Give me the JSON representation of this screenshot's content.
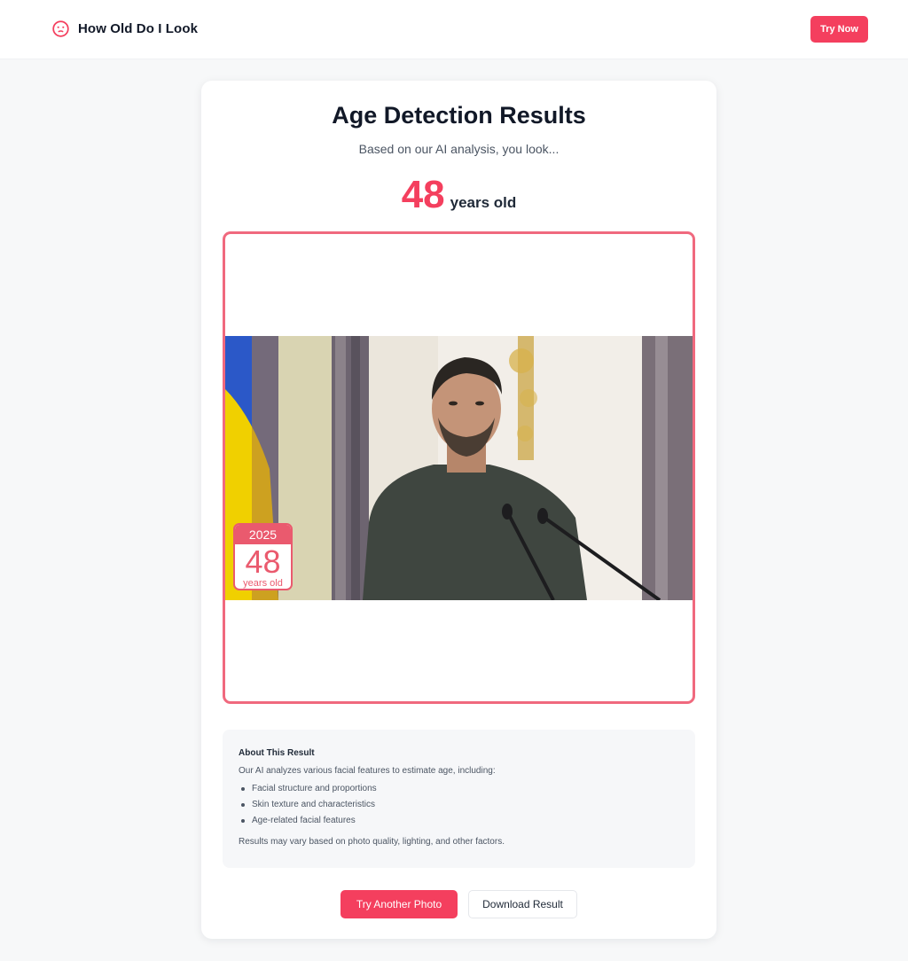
{
  "header": {
    "brand_title": "How Old Do I Look",
    "brand_icon": "face-icon",
    "try_now_label": "Try Now"
  },
  "result": {
    "title": "Age Detection Results",
    "subtitle": "Based on our AI analysis, you look...",
    "age": "48",
    "age_unit": "years old"
  },
  "photo": {
    "badge_year": "2025",
    "badge_age": "48",
    "badge_unit": "years old"
  },
  "about": {
    "title": "About This Result",
    "intro": "Our AI analyzes various facial features to estimate age, including:",
    "items": [
      "Facial structure and proportions",
      "Skin texture and characteristics",
      "Age-related facial features"
    ],
    "note": "Results may vary based on photo quality, lighting, and other factors."
  },
  "actions": {
    "try_another_label": "Try Another Photo",
    "download_label": "Download Result"
  },
  "colors": {
    "accent": "#f43f5e",
    "frame": "#f0697e",
    "badge": "#ea5a6e",
    "page_background": "#f7f8f9"
  }
}
